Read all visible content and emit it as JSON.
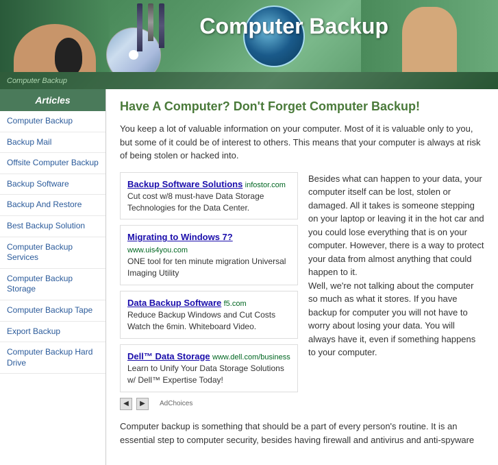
{
  "header": {
    "title": "Computer Backup",
    "overlay_text": "Computer Backup"
  },
  "sidebar": {
    "heading": "Articles",
    "items": [
      {
        "label": "Computer Backup"
      },
      {
        "label": "Backup Mail"
      },
      {
        "label": "Offsite Computer Backup"
      },
      {
        "label": "Backup Software"
      },
      {
        "label": "Backup And Restore"
      },
      {
        "label": "Best Backup Solution"
      },
      {
        "label": "Computer Backup Services"
      },
      {
        "label": "Computer Backup Storage"
      },
      {
        "label": "Computer Backup Tape"
      },
      {
        "label": "Export Backup"
      },
      {
        "label": "Computer Backup Hard Drive"
      }
    ]
  },
  "content": {
    "title": "Have A Computer? Don't Forget Computer Backup!",
    "intro": "You keep a lot of valuable information on your computer. Most of it is valuable only to you, but some of it could be of interest to others. This means that your computer is always at risk of being stolen or hacked into.",
    "ads": [
      {
        "title": "Backup Software Solutions",
        "url": "infostor.com",
        "desc": "Cut cost w/8 must-have Data Storage Technologies for the Data Center."
      },
      {
        "title": "Migrating to Windows 7?",
        "url": "www.uis4you.com",
        "desc": "ONE tool for ten minute migration Universal Imaging Utility"
      },
      {
        "title": "Data Backup Software",
        "url": "f5.com",
        "desc": "Reduce Backup Windows and Cut Costs Watch the 6min. Whiteboard Video."
      },
      {
        "title": "Dell™ Data Storage",
        "url": "www.dell.com/business",
        "desc": "Learn to Unify Your Data Storage Solutions w/ Dell™ Expertise Today!"
      }
    ],
    "ad_choices": "AdChoices",
    "right_col": "Besides what can happen to your data, your computer itself can be lost, stolen or damaged. All it takes is someone stepping on your laptop or leaving it in the hot car and you could lose everything that is on your computer. However, there is a way to protect your data from almost anything that could happen to it.",
    "para2": "Well, we're not talking about the computer so much as what it stores. If you have backup for computer you will not have to worry about losing your data. You will always have it, even if something happens to your computer.",
    "para3": "Computer backup is something that should be a part of every person's routine. It is an essential step to computer security, besides having firewall and antivirus and anti-spyware"
  }
}
